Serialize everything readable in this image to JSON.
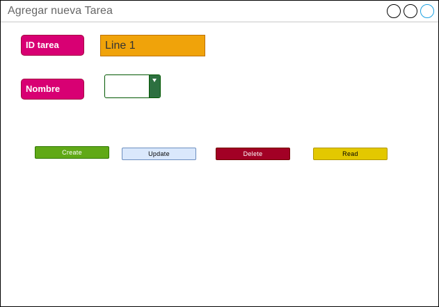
{
  "window": {
    "title": "Agregar nueva Tarea"
  },
  "form": {
    "id_label": "ID tarea",
    "id_value": "Line 1",
    "name_label": "Nombre",
    "name_value": ""
  },
  "actions": {
    "create": "Create",
    "update": "Update",
    "delete": "Delete",
    "read": "Read"
  },
  "colors": {
    "label_bg": "#d80073",
    "id_field_bg": "#f0a30a",
    "select_arrow_bg": "#2d7040",
    "create_bg": "#60a917",
    "update_bg": "#dae8fc",
    "delete_bg": "#a20025",
    "read_bg": "#e3c800",
    "window_accent": "#1ba1e2"
  },
  "icons": {
    "dropdown": "triangle-down-icon",
    "window_controls": [
      "circle-icon",
      "circle-icon",
      "circle-icon"
    ]
  }
}
